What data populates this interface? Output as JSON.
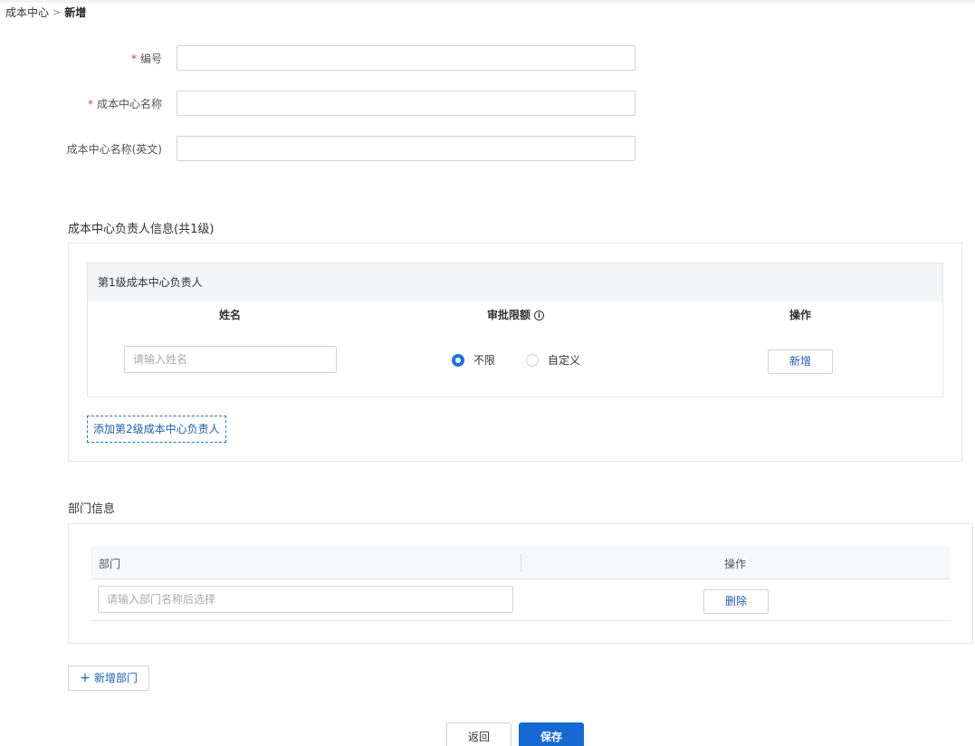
{
  "breadcrumb": {
    "parent": "成本中心",
    "separator": ">",
    "current": "新增"
  },
  "form": {
    "code_label": "编号",
    "name_label": "成本中心名称",
    "name_en_label": "成本中心名称(英文)",
    "required_mark": "*"
  },
  "approvers": {
    "section_title": "成本中心负责人信息(共1级)",
    "level_title": "第1级成本中心负责人",
    "col_name": "姓名",
    "col_limit": "审批限额",
    "col_action": "操作",
    "info_icon": "info-icon",
    "name_placeholder": "请输入姓名",
    "radio_unlimited": "不限",
    "radio_custom": "自定义",
    "selected": "不限",
    "add_button": "新增",
    "add_level_button": "添加第2级成本中心负责人"
  },
  "departments": {
    "section_title": "部门信息",
    "col_dept": "部门",
    "col_action": "操作",
    "dept_placeholder": "请输入部门名称后选择",
    "delete_button": "删除",
    "add_button": "新增部门"
  },
  "footer": {
    "back_label": "返回",
    "save_label": "保存"
  },
  "colors": {
    "primary": "#1668d3",
    "required": "#e0443a",
    "link": "#1f5fb0"
  }
}
